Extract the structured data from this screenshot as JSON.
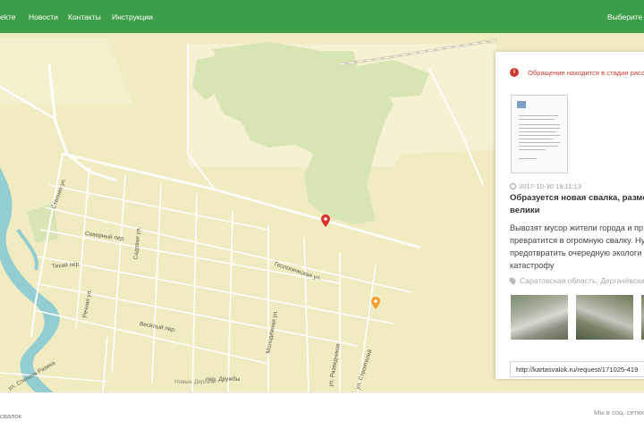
{
  "navbar": {
    "items": [
      "ekте",
      "Новости",
      "Контакты",
      "Инструкции"
    ],
    "right_label": "Выберите ре"
  },
  "map": {
    "street_labels": [
      "Степная ул.",
      "Северный пер.",
      "Садовая ул.",
      "Тихий пер.",
      "Речная ул.",
      "Геологическая ул.",
      "Весёлый пер.",
      "Молодёжная ул.",
      "ул. Степана Разина",
      "пер. Дружбы",
      "ул. Разведчиков",
      "ул. Строителей",
      "Новые Дергачи"
    ]
  },
  "panel": {
    "status": "Обращение находится в стадии расс",
    "date": "2017-10-30 19:11:13",
    "title": "Образуется новая свалка, размеры велики",
    "description": "Вывозят мусор жители города и пр превратится в огромную свалку. Ну предотвратить очередную экологи катастрофу",
    "address": "Саратовская область, Дергачёвский",
    "url": "http://kartasvalok.ru/request/171025-419"
  },
  "footer": {
    "left_text": "свалок",
    "right_text": "Мы в соц. сетях:"
  },
  "colors": {
    "navbar": "#3d9e48",
    "map_base": "#f1ebc2",
    "status_red": "#c83a32",
    "marker_red": "#d9322e",
    "marker_orange": "#f0a02a"
  },
  "icons": {
    "status": "info-circle-icon",
    "date": "clock-icon",
    "address": "map-pin-icon"
  }
}
